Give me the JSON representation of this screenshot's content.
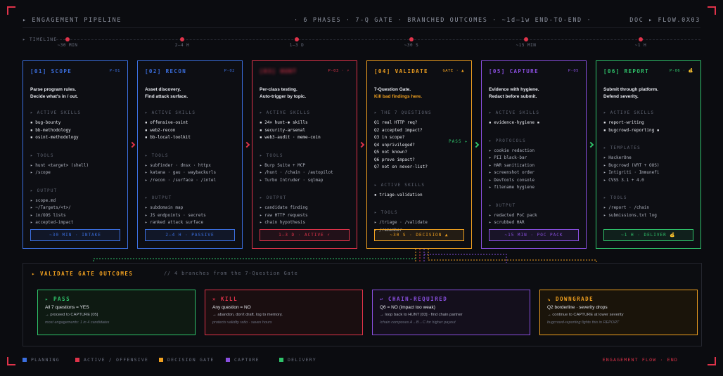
{
  "header": {
    "left": "▸ ENGAGEMENT PIPELINE",
    "center": "· 6 PHASES · 7-Q GATE · BRANCHED OUTCOMES · ~1d–1w END-TO-END ·",
    "right": "DOC ▸ FLOW.0X03"
  },
  "timeline": {
    "label": "▸ TIMELINE",
    "ticks": [
      "~30 MIN",
      "2–4 H",
      "1–3 D",
      "~30 S",
      "~15 MIN",
      "~1 H"
    ]
  },
  "colors": {
    "planning": "#3b6fe0",
    "active": "#e0334a",
    "gate": "#f0a020",
    "capture": "#8a4fe0",
    "delivery": "#2fc26a"
  },
  "phases": [
    {
      "title": "[01] SCOPE",
      "tag": "P-01",
      "desc": [
        "Parse program rules.",
        "Decide what's in / out."
      ],
      "sections": [
        {
          "label": "▸ ACTIVE SKILLS",
          "items": [
            "▪ bug-bounty",
            "▪ bb-methodology",
            "▪ osint-methodology"
          ],
          "skill": true
        },
        {
          "label": "▸ TOOLS",
          "items": [
            "▸ hunt <target> (shell)",
            "▸ /scope"
          ]
        },
        {
          "label": "▸ OUTPUT",
          "items": [
            "▸ scope.md",
            "▸ ~/Targets/<t>/",
            "▸ in/OOS lists",
            "▸ accepted-impact"
          ]
        }
      ],
      "footer": "~30 MIN · INTAKE"
    },
    {
      "title": "[02] RECON",
      "tag": "P-02",
      "desc": [
        "Asset discovery.",
        "Find attack surface."
      ],
      "sections": [
        {
          "label": "▸ ACTIVE SKILLS",
          "items": [
            "▪ offensive-osint",
            "▪ web2-recon",
            "▪ bb-local-toolkit"
          ],
          "skill": true
        },
        {
          "label": "▸ TOOLS",
          "items": [
            "▸ subfinder · dnsx · httpx",
            "▸ katana · gau · waybackurls",
            "▸ /recon · /surface · /intel"
          ]
        },
        {
          "label": "▸ OUTPUT",
          "items": [
            "▸ subdomain map",
            "▸ JS endpoints · secrets",
            "▸ ranked attack surface"
          ]
        }
      ],
      "footer": "2–4 H · PASSIVE"
    },
    {
      "title": "[03] HUNT",
      "tag": "P-03 · ⚡",
      "desc": [
        "Per-class testing.",
        "Auto-trigger by topic."
      ],
      "sections": [
        {
          "label": "▸ ACTIVE SKILLS",
          "items": [
            "▪ 24× hunt-✱ skills",
            "▪ security-arsenal",
            "▪ web3-audit · meme-coin"
          ],
          "skill": true
        },
        {
          "label": "▸ TOOLS",
          "items": [
            "▸ Burp Suite + MCP",
            "▸ /hunt · /chain · /autopilot",
            "▸ Turbo Intruder · sqlmap"
          ]
        },
        {
          "label": "▸ OUTPUT",
          "items": [
            "▸ candidate finding",
            "▸ raw HTTP requests",
            "▸ chain hypothesis"
          ]
        }
      ],
      "footer": "1–3 D · ACTIVE ⚡"
    },
    {
      "title": "[04] VALIDATE",
      "tag": "GATE · ▲",
      "desc": [
        "7-Question Gate.",
        "Kill bad findings here."
      ],
      "sections": [
        {
          "label": "▸ THE 7 QUESTIONS",
          "items": [
            "Q1 real HTTP req?",
            "Q2 accepted impact?",
            "Q3 in scope?",
            "Q4 unprivileged?",
            "Q5 not known?",
            "Q6 prove impact?",
            "Q7 not on never-list?"
          ],
          "skill": true
        },
        {
          "label": "▸ ACTIVE SKILLS",
          "items": [
            "▪ triage-validation"
          ],
          "skill": true
        },
        {
          "label": "▸ TOOLS",
          "items": [
            "▸ /triage · /validate",
            "▸ /remember"
          ]
        }
      ],
      "footer": "~30 S · DECISION ▲"
    },
    {
      "title": "[05] CAPTURE",
      "tag": "P-05",
      "desc": [
        "Evidence with hygiene.",
        "Redact before submit."
      ],
      "sections": [
        {
          "label": "▸ ACTIVE SKILLS",
          "items": [
            "▪ evidence-hygiene ▪"
          ],
          "skill": true
        },
        {
          "label": "▸ PROTOCOLS",
          "items": [
            "▸ cookie redaction",
            "▸ PII black-bar",
            "▸ HAR sanitization",
            "▸ screenshot order",
            "▸ DevTools console",
            "▸ filename hygiene"
          ]
        },
        {
          "label": "▸ OUTPUT",
          "items": [
            "▸ redacted PoC pack",
            "▸ scrubbed HAR"
          ]
        }
      ],
      "footer": "~15 MIN · POC PACK"
    },
    {
      "title": "[06] REPORT",
      "tag": "P-06 · 💰",
      "desc": [
        "Submit through platform.",
        "Defend severity."
      ],
      "sections": [
        {
          "label": "▸ ACTIVE SKILLS",
          "items": [
            "▪ report-writing",
            "▪ bugcrowd-reporting ▪"
          ],
          "skill": true
        },
        {
          "label": "▸ TEMPLATES",
          "items": [
            "▸ HackerOne",
            "▸ Bugcrowd (VRT + OOS)",
            "▸ Intigriti · Immunefi",
            "▸ CVSS 3.1 + 4.0"
          ]
        },
        {
          "label": "▸ TOOLS",
          "items": [
            "▸ /report · /chain",
            "▸ submissions.txt log"
          ]
        }
      ],
      "footer": "~1 H · DELIVER 💰"
    }
  ],
  "pass_label": "PASS ▸",
  "gate": {
    "title": "▸ VALIDATE GATE OUTCOMES",
    "subtitle": "// 4 branches from the 7-Question Gate",
    "outcomes": [
      {
        "head": "▸ PASS",
        "l1": "All 7 questions = YES",
        "l2": "→ proceed to CAPTURE [05]",
        "l3": "most engagements: 1 in 4 candidates"
      },
      {
        "head": "✕ KILL",
        "l1": "Any question = NO",
        "l2": "→ abandon, don't draft. log to memory.",
        "l3": "protects validity ratio · saves hours"
      },
      {
        "head": "↩ CHAIN-REQUIRED",
        "l1": "Q6 = NO (impact too weak)",
        "l2": "→ loop back to HUNT [03] · find chain partner",
        "l3": "/chain composes A→B→C for higher payout"
      },
      {
        "head": "↘ DOWNGRADE",
        "l1": "Q2 borderline · severity drops",
        "l2": "→ continue to CAPTURE at lower severity",
        "l3": "bugcrowd-reporting fights this in REPORT"
      }
    ]
  },
  "legend": [
    "PLANNING",
    "ACTIVE / OFFENSIVE",
    "DECISION GATE",
    "CAPTURE",
    "DELIVERY"
  ],
  "footer_end": "ENGAGEMENT FLOW · END"
}
